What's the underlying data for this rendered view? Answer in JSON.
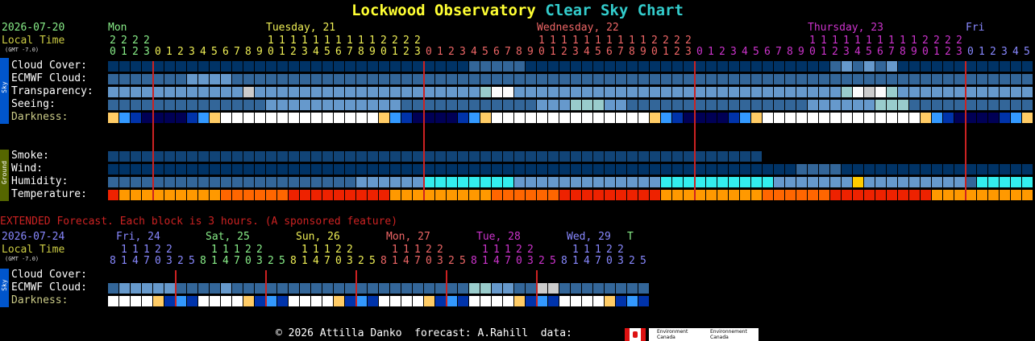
{
  "header": {
    "title_main": "Lockwood Observatory",
    "title_sub": "Clear Sky Chart"
  },
  "top": {
    "date": "2026-07-20",
    "local_time": "Local Time",
    "gmt": "(GMT -7.0)",
    "days": [
      {
        "label": "Mon",
        "color": "#88ee88"
      },
      {
        "label": "Tuesday, 21",
        "color": "#eeee55"
      },
      {
        "label": "Wednesday, 22",
        "color": "#ee6666"
      },
      {
        "label": "Thursday, 23",
        "color": "#cc33cc"
      },
      {
        "label": "Fri",
        "color": "#8888ff"
      }
    ],
    "tens_row": "2222   11111111112222   11111111112222   11111111112222",
    "hours_row": "0123012345678901234567890123012345678901234567890123012345678901234567890123012345678901234567890123012345",
    "hour_colors": [
      "#88ee88",
      "#eeee55",
      "#ee6666",
      "#cc33cc",
      "#8888ff"
    ]
  },
  "sky_rows": [
    {
      "label": "Cloud Cover:"
    },
    {
      "label": "ECMWF Cloud:"
    },
    {
      "label": "Transparency:"
    },
    {
      "label": "Seeing:"
    },
    {
      "label": "Darkness:",
      "dim": true
    }
  ],
  "ground_rows": [
    {
      "label": "Smoke:"
    },
    {
      "label": "Wind:"
    },
    {
      "label": "Humidity:"
    },
    {
      "label": "Temperature:"
    }
  ],
  "side_tabs": {
    "sky": "Sky",
    "ground": "Ground"
  },
  "extended": {
    "notice": "EXTENDED Forecast. Each block is 3 hours. (A sponsored feature)",
    "date": "2026-07-24",
    "local_time": "Local Time",
    "gmt": "(GMT -7.0)",
    "days": [
      {
        "label": "Fri, 24",
        "color": "#8888ff"
      },
      {
        "label": "Sat, 25",
        "color": "#88ee88"
      },
      {
        "label": "Sun, 26",
        "color": "#eeee55"
      },
      {
        "label": "Mon, 27",
        "color": "#ee6666"
      },
      {
        "label": "Tue, 28",
        "color": "#cc33cc"
      },
      {
        "label": "Wed, 29",
        "color": "#8888ff"
      },
      {
        "label": "T",
        "color": "#88ee88"
      }
    ],
    "tens_row": "11122",
    "hours_row": "81470325",
    "rows": [
      {
        "label": "Cloud Cover:"
      },
      {
        "label": "ECMWF Cloud:"
      },
      {
        "label": "Darkness:",
        "dim": true
      }
    ]
  },
  "footer": {
    "copyright": "© 2026 Attilla Danko  forecast: A.Rahill  data:",
    "env1a": "Environment",
    "env1b": "Canada",
    "env2a": "Environnement",
    "env2b": "Canada"
  },
  "colors": {
    "cloud_dark": "#003366",
    "cloud_mid": "#336699",
    "cloud_light": "#6699cc",
    "cloud_lighter": "#99cccc",
    "cloud_white": "#fbfbfb",
    "divider": "#cc2222",
    "dark_night": "#000055",
    "dark_blue": "#0033aa",
    "dark_sky": "#3399ff",
    "day_white": "#ffffff",
    "twilight": "#ffcc66",
    "temp_orange": "#ff6600",
    "temp_red": "#ee2200",
    "temp_amber": "#ff9900",
    "smoke": "#114477",
    "hum_cyan": "#33eeee",
    "hum_green": "#66ffcc"
  }
}
